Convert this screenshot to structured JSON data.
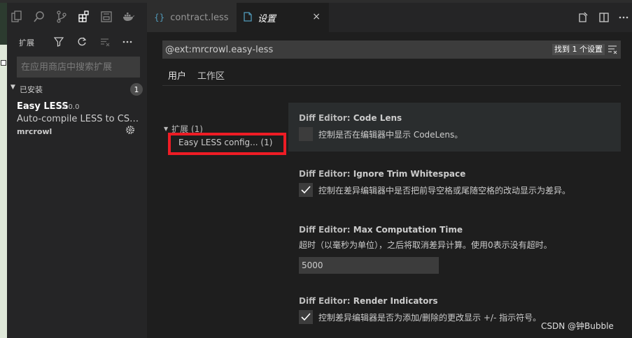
{
  "activity_bar": {
    "icons": [
      "explorer-icon",
      "search-icon",
      "source-control-icon",
      "extensions-icon",
      "remote-explorer-icon",
      "docker-icon"
    ]
  },
  "sidebar": {
    "title": "扩展",
    "search_placeholder": "在应用商店中搜索扩展",
    "installed": {
      "label": "已安装",
      "count": "1",
      "items": [
        {
          "name": "Easy LESS",
          "version": "2.0.0",
          "description": "Auto-compile LESS to CSS o...",
          "author": "mrcrowl"
        }
      ]
    }
  },
  "tabs": [
    {
      "label": "contract.less",
      "icon": "{}",
      "active": false
    },
    {
      "label": "设置",
      "icon": "settings-file-icon",
      "active": true,
      "close": "×"
    }
  ],
  "settings": {
    "search_value": "@ext:mrcrowl.easy-less",
    "result_count": "找到 1 个设置",
    "scopes": {
      "user": "用户",
      "workspace": "工作区"
    },
    "toc": {
      "header": "扩展 (1)",
      "item": "Easy LESS config... (1)"
    },
    "items": [
      {
        "category": "Diff Editor: ",
        "title": "Code Lens",
        "description": "控制是否在编辑器中显示 CodeLens。",
        "checked": false
      },
      {
        "category": "Diff Editor: ",
        "title": "Ignore Trim Whitespace",
        "description": "控制在差异编辑器中是否把前导空格或尾随空格的改动显示为差异。",
        "checked": true
      },
      {
        "category": "Diff Editor: ",
        "title": "Max Computation Time",
        "description": "超时（以毫秒为单位），之后将取消差异计算。使用0表示没有超时。",
        "value": "5000"
      },
      {
        "category": "Diff Editor: ",
        "title": "Render Indicators",
        "description": "控制差异编辑器是否为添加/删除的更改显示 +/- 指示符号。",
        "checked": true
      }
    ]
  },
  "watermark": "CSDN @钟Bubble"
}
